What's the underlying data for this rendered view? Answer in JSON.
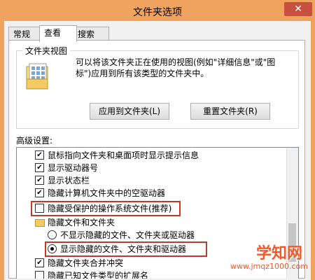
{
  "window": {
    "title": "文件夹选项",
    "close_glyph": "✕",
    "close_color": "#c7503e",
    "accent": "#f0a35e"
  },
  "tabs": [
    {
      "label": "常规"
    },
    {
      "label": "查看"
    },
    {
      "label": "搜索"
    }
  ],
  "active_tab": "查看",
  "folder_view": {
    "legend": "文件夹视图",
    "description": "可以将该文件夹正在使用的视图(例如\"详细信息\"或\"图标\")应用到所有该类型的文件夹中。",
    "apply_button": "应用到文件夹(L)",
    "reset_button": "重置文件夹(R)"
  },
  "advanced": {
    "label": "高级设置:",
    "items": [
      {
        "type": "checkbox",
        "checked": true,
        "label": "鼠标指向文件夹和桌面项时显示提示信息"
      },
      {
        "type": "checkbox",
        "checked": true,
        "label": "显示驱动器号"
      },
      {
        "type": "checkbox",
        "checked": true,
        "label": "显示状态栏"
      },
      {
        "type": "checkbox",
        "checked": true,
        "label": "隐藏计算机文件夹中的空驱动器"
      },
      {
        "type": "checkbox",
        "checked": false,
        "label": "隐藏受保护的操作系统文件(推荐)"
      },
      {
        "type": "folder",
        "label": "隐藏文件和文件夹"
      },
      {
        "type": "radio",
        "checked": false,
        "label": "不显示隐藏的文件、文件夹或驱动器"
      },
      {
        "type": "radio",
        "checked": true,
        "label": "显示隐藏的文件、文件夹和驱动器"
      },
      {
        "type": "checkbox",
        "checked": true,
        "label": "隐藏文件夹合并冲突"
      },
      {
        "type": "checkbox",
        "checked": false,
        "label": "隐藏已知文件类型的扩展名"
      }
    ],
    "check_glyph": "✔"
  },
  "watermark": {
    "big": "学知网",
    "small": "www.jmqz1000.com"
  }
}
